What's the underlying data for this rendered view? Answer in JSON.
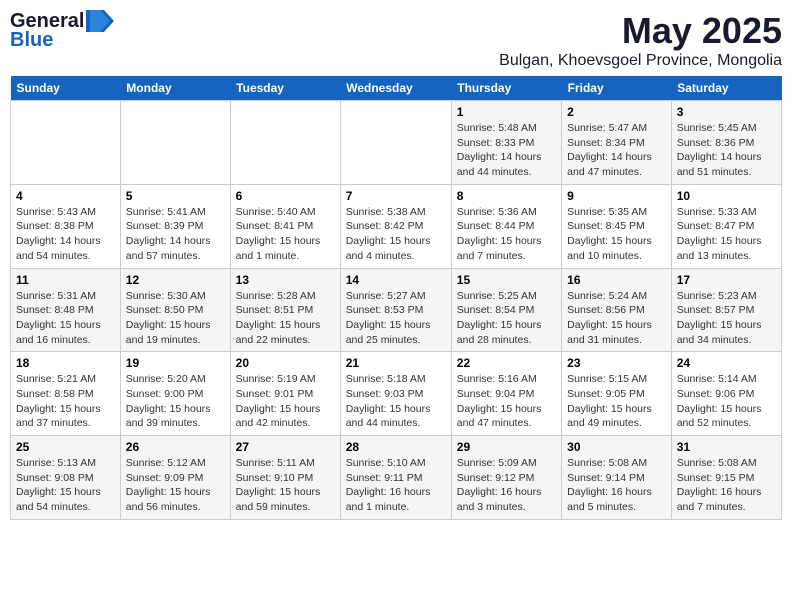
{
  "logo": {
    "general": "General",
    "blue": "Blue"
  },
  "title": {
    "month": "May 2025",
    "location": "Bulgan, Khoevsgoel Province, Mongolia"
  },
  "headers": [
    "Sunday",
    "Monday",
    "Tuesday",
    "Wednesday",
    "Thursday",
    "Friday",
    "Saturday"
  ],
  "weeks": [
    [
      {
        "day": "",
        "info": ""
      },
      {
        "day": "",
        "info": ""
      },
      {
        "day": "",
        "info": ""
      },
      {
        "day": "",
        "info": ""
      },
      {
        "day": "1",
        "info": "Sunrise: 5:48 AM\nSunset: 8:33 PM\nDaylight: 14 hours and 44 minutes."
      },
      {
        "day": "2",
        "info": "Sunrise: 5:47 AM\nSunset: 8:34 PM\nDaylight: 14 hours and 47 minutes."
      },
      {
        "day": "3",
        "info": "Sunrise: 5:45 AM\nSunset: 8:36 PM\nDaylight: 14 hours and 51 minutes."
      }
    ],
    [
      {
        "day": "4",
        "info": "Sunrise: 5:43 AM\nSunset: 8:38 PM\nDaylight: 14 hours and 54 minutes."
      },
      {
        "day": "5",
        "info": "Sunrise: 5:41 AM\nSunset: 8:39 PM\nDaylight: 14 hours and 57 minutes."
      },
      {
        "day": "6",
        "info": "Sunrise: 5:40 AM\nSunset: 8:41 PM\nDaylight: 15 hours and 1 minute."
      },
      {
        "day": "7",
        "info": "Sunrise: 5:38 AM\nSunset: 8:42 PM\nDaylight: 15 hours and 4 minutes."
      },
      {
        "day": "8",
        "info": "Sunrise: 5:36 AM\nSunset: 8:44 PM\nDaylight: 15 hours and 7 minutes."
      },
      {
        "day": "9",
        "info": "Sunrise: 5:35 AM\nSunset: 8:45 PM\nDaylight: 15 hours and 10 minutes."
      },
      {
        "day": "10",
        "info": "Sunrise: 5:33 AM\nSunset: 8:47 PM\nDaylight: 15 hours and 13 minutes."
      }
    ],
    [
      {
        "day": "11",
        "info": "Sunrise: 5:31 AM\nSunset: 8:48 PM\nDaylight: 15 hours and 16 minutes."
      },
      {
        "day": "12",
        "info": "Sunrise: 5:30 AM\nSunset: 8:50 PM\nDaylight: 15 hours and 19 minutes."
      },
      {
        "day": "13",
        "info": "Sunrise: 5:28 AM\nSunset: 8:51 PM\nDaylight: 15 hours and 22 minutes."
      },
      {
        "day": "14",
        "info": "Sunrise: 5:27 AM\nSunset: 8:53 PM\nDaylight: 15 hours and 25 minutes."
      },
      {
        "day": "15",
        "info": "Sunrise: 5:25 AM\nSunset: 8:54 PM\nDaylight: 15 hours and 28 minutes."
      },
      {
        "day": "16",
        "info": "Sunrise: 5:24 AM\nSunset: 8:56 PM\nDaylight: 15 hours and 31 minutes."
      },
      {
        "day": "17",
        "info": "Sunrise: 5:23 AM\nSunset: 8:57 PM\nDaylight: 15 hours and 34 minutes."
      }
    ],
    [
      {
        "day": "18",
        "info": "Sunrise: 5:21 AM\nSunset: 8:58 PM\nDaylight: 15 hours and 37 minutes."
      },
      {
        "day": "19",
        "info": "Sunrise: 5:20 AM\nSunset: 9:00 PM\nDaylight: 15 hours and 39 minutes."
      },
      {
        "day": "20",
        "info": "Sunrise: 5:19 AM\nSunset: 9:01 PM\nDaylight: 15 hours and 42 minutes."
      },
      {
        "day": "21",
        "info": "Sunrise: 5:18 AM\nSunset: 9:03 PM\nDaylight: 15 hours and 44 minutes."
      },
      {
        "day": "22",
        "info": "Sunrise: 5:16 AM\nSunset: 9:04 PM\nDaylight: 15 hours and 47 minutes."
      },
      {
        "day": "23",
        "info": "Sunrise: 5:15 AM\nSunset: 9:05 PM\nDaylight: 15 hours and 49 minutes."
      },
      {
        "day": "24",
        "info": "Sunrise: 5:14 AM\nSunset: 9:06 PM\nDaylight: 15 hours and 52 minutes."
      }
    ],
    [
      {
        "day": "25",
        "info": "Sunrise: 5:13 AM\nSunset: 9:08 PM\nDaylight: 15 hours and 54 minutes."
      },
      {
        "day": "26",
        "info": "Sunrise: 5:12 AM\nSunset: 9:09 PM\nDaylight: 15 hours and 56 minutes."
      },
      {
        "day": "27",
        "info": "Sunrise: 5:11 AM\nSunset: 9:10 PM\nDaylight: 15 hours and 59 minutes."
      },
      {
        "day": "28",
        "info": "Sunrise: 5:10 AM\nSunset: 9:11 PM\nDaylight: 16 hours and 1 minute."
      },
      {
        "day": "29",
        "info": "Sunrise: 5:09 AM\nSunset: 9:12 PM\nDaylight: 16 hours and 3 minutes."
      },
      {
        "day": "30",
        "info": "Sunrise: 5:08 AM\nSunset: 9:14 PM\nDaylight: 16 hours and 5 minutes."
      },
      {
        "day": "31",
        "info": "Sunrise: 5:08 AM\nSunset: 9:15 PM\nDaylight: 16 hours and 7 minutes."
      }
    ]
  ]
}
